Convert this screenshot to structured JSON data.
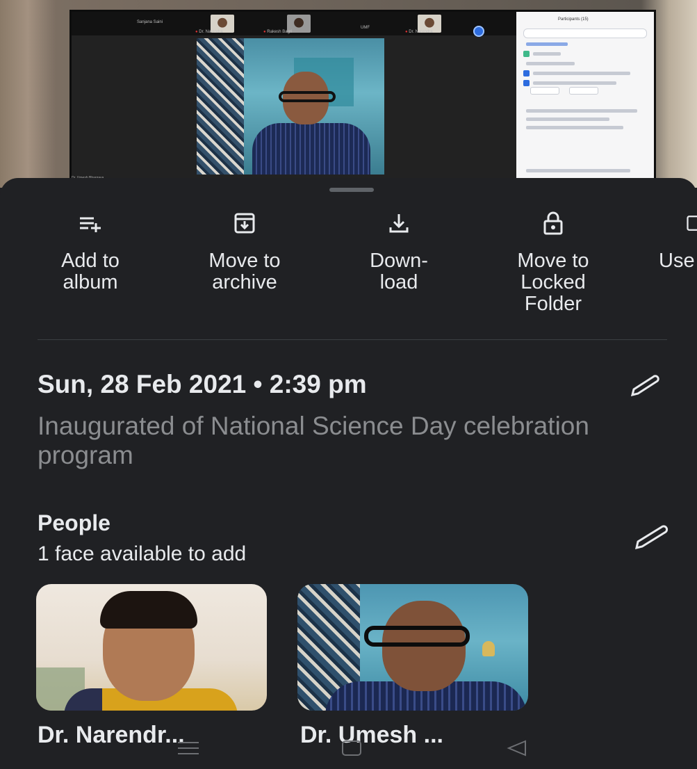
{
  "photo": {
    "meeting_names": [
      "Sanjana Saini",
      "Dr. Narendra",
      "Rakesh Bagri",
      "UMF",
      "Dr. Narendra"
    ],
    "panel_title": "Participants (15)",
    "speaker_caption": "Dr. Umesh Bhargava"
  },
  "actions": [
    {
      "label": "Add to\nalbum",
      "icon": "add-to-playlist-icon"
    },
    {
      "label": "Move to\narchive",
      "icon": "archive-icon"
    },
    {
      "label": "Down-\nload",
      "icon": "download-icon"
    },
    {
      "label": "Move to\nLocked\nFolder",
      "icon": "lock-icon"
    },
    {
      "label": "Use",
      "icon": "use-as-icon"
    }
  ],
  "details": {
    "datetime": "Sun, 28 Feb 2021  •  2:39 pm",
    "description": "Inaugurated of National Science Day celebration program"
  },
  "people": {
    "title": "People",
    "subtitle": "1 face available to add",
    "faces": [
      {
        "name": "Dr. Narendr..."
      },
      {
        "name": "Dr. Umesh ..."
      }
    ]
  },
  "navbar": {
    "icons": [
      "menu-icon",
      "home-icon",
      "back-icon"
    ]
  }
}
